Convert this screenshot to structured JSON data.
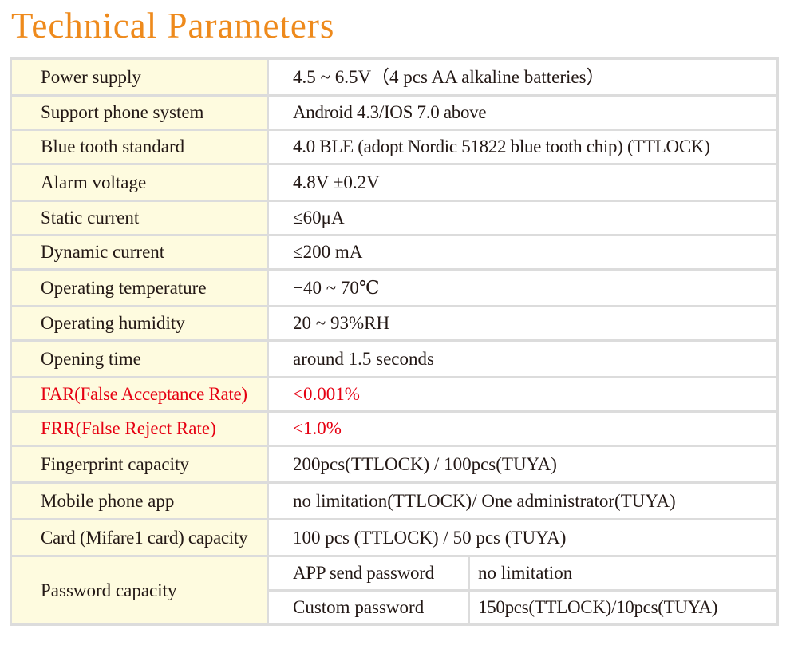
{
  "title": "Technical Parameters",
  "colors": {
    "title": "#ee8a1c",
    "label_background": "#fefbdf",
    "highlight_text": "#e60012",
    "border": "#dcdcdc"
  },
  "rows": [
    {
      "label": "Power supply",
      "value": "4.5 ~ 6.5V（4 pcs AA alkaline batteries）"
    },
    {
      "label": "Support phone system",
      "value": "Android 4.3/IOS 7.0 above"
    },
    {
      "label": "Blue tooth standard",
      "value": "4.0 BLE (adopt Nordic 51822 blue tooth chip) (TTLOCK)"
    },
    {
      "label": "Alarm voltage",
      "value": "4.8V  ±0.2V"
    },
    {
      "label": "Static current",
      "value": "≤60μA"
    },
    {
      "label": "Dynamic current",
      "value": "≤200 mA"
    },
    {
      "label": "Operating temperature",
      "value": "−40 ~ 70℃"
    },
    {
      "label": "Operating humidity",
      "value": "20 ~ 93%RH"
    },
    {
      "label": "Opening time",
      "value": "around 1.5 seconds"
    },
    {
      "label": "FAR(False Acceptance Rate)",
      "value": "<0.001%",
      "highlight": true
    },
    {
      "label": "FRR(False Reject Rate)",
      "value": "<1.0%",
      "highlight": true
    },
    {
      "label": "Fingerprint capacity",
      "value": "200pcs(TTLOCK) / 100pcs(TUYA)"
    },
    {
      "label": "Mobile phone app",
      "value": "no limitation(TTLOCK)/ One administrator(TUYA)"
    },
    {
      "label": "Card (Mifare1 card) capacity",
      "value": "100 pcs (TTLOCK) / 50 pcs (TUYA)"
    }
  ],
  "password": {
    "label": "Password capacity",
    "sub": [
      {
        "label": "APP send password",
        "value": "no limitation"
      },
      {
        "label": "Custom password",
        "value": "150pcs(TTLOCK)/10pcs(TUYA)"
      }
    ]
  }
}
